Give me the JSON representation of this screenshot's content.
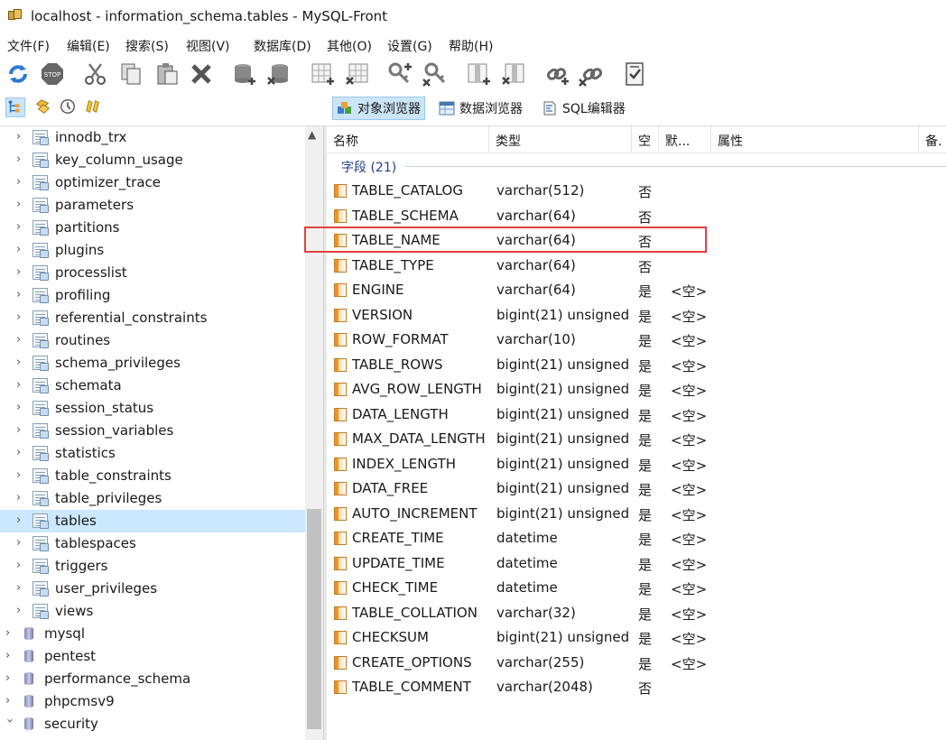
{
  "window": {
    "title": "localhost - information_schema.tables - MySQL-Front"
  },
  "menu": [
    "文件(F)",
    "编辑(E)",
    "搜索(S)",
    "视图(V)",
    "数据库(D)",
    "其他(O)",
    "设置(G)",
    "帮助(H)"
  ],
  "views": {
    "object_browser": "对象浏览器",
    "data_browser": "数据浏览器",
    "sql_editor": "SQL编辑器"
  },
  "tree": {
    "items": [
      {
        "label": "innodb_trx",
        "kind": "table"
      },
      {
        "label": "key_column_usage",
        "kind": "table"
      },
      {
        "label": "optimizer_trace",
        "kind": "table"
      },
      {
        "label": "parameters",
        "kind": "table"
      },
      {
        "label": "partitions",
        "kind": "table"
      },
      {
        "label": "plugins",
        "kind": "table"
      },
      {
        "label": "processlist",
        "kind": "table"
      },
      {
        "label": "profiling",
        "kind": "table"
      },
      {
        "label": "referential_constraints",
        "kind": "table"
      },
      {
        "label": "routines",
        "kind": "table"
      },
      {
        "label": "schema_privileges",
        "kind": "table"
      },
      {
        "label": "schemata",
        "kind": "table"
      },
      {
        "label": "session_status",
        "kind": "table"
      },
      {
        "label": "session_variables",
        "kind": "table"
      },
      {
        "label": "statistics",
        "kind": "table"
      },
      {
        "label": "table_constraints",
        "kind": "table"
      },
      {
        "label": "table_privileges",
        "kind": "table"
      },
      {
        "label": "tables",
        "kind": "table",
        "selected": true
      },
      {
        "label": "tablespaces",
        "kind": "table"
      },
      {
        "label": "triggers",
        "kind": "table"
      },
      {
        "label": "user_privileges",
        "kind": "table"
      },
      {
        "label": "views",
        "kind": "table"
      },
      {
        "label": "mysql",
        "kind": "database"
      },
      {
        "label": "pentest",
        "kind": "database"
      },
      {
        "label": "performance_schema",
        "kind": "database"
      },
      {
        "label": "phpcmsv9",
        "kind": "database"
      },
      {
        "label": "security",
        "kind": "database",
        "expanded": true
      }
    ]
  },
  "grid": {
    "columns": [
      "名称",
      "类型",
      "空",
      "默...",
      "属性",
      "备."
    ],
    "group_label": "字段 (21)",
    "rows": [
      {
        "name": "TABLE_CATALOG",
        "type": "varchar(512)",
        "null": "否",
        "default": ""
      },
      {
        "name": "TABLE_SCHEMA",
        "type": "varchar(64)",
        "null": "否",
        "default": ""
      },
      {
        "name": "TABLE_NAME",
        "type": "varchar(64)",
        "null": "否",
        "default": ""
      },
      {
        "name": "TABLE_TYPE",
        "type": "varchar(64)",
        "null": "否",
        "default": ""
      },
      {
        "name": "ENGINE",
        "type": "varchar(64)",
        "null": "是",
        "default": "<空>"
      },
      {
        "name": "VERSION",
        "type": "bigint(21) unsigned",
        "null": "是",
        "default": "<空>"
      },
      {
        "name": "ROW_FORMAT",
        "type": "varchar(10)",
        "null": "是",
        "default": "<空>"
      },
      {
        "name": "TABLE_ROWS",
        "type": "bigint(21) unsigned",
        "null": "是",
        "default": "<空>"
      },
      {
        "name": "AVG_ROW_LENGTH",
        "type": "bigint(21) unsigned",
        "null": "是",
        "default": "<空>"
      },
      {
        "name": "DATA_LENGTH",
        "type": "bigint(21) unsigned",
        "null": "是",
        "default": "<空>"
      },
      {
        "name": "MAX_DATA_LENGTH",
        "type": "bigint(21) unsigned",
        "null": "是",
        "default": "<空>"
      },
      {
        "name": "INDEX_LENGTH",
        "type": "bigint(21) unsigned",
        "null": "是",
        "default": "<空>"
      },
      {
        "name": "DATA_FREE",
        "type": "bigint(21) unsigned",
        "null": "是",
        "default": "<空>"
      },
      {
        "name": "AUTO_INCREMENT",
        "type": "bigint(21) unsigned",
        "null": "是",
        "default": "<空>"
      },
      {
        "name": "CREATE_TIME",
        "type": "datetime",
        "null": "是",
        "default": "<空>"
      },
      {
        "name": "UPDATE_TIME",
        "type": "datetime",
        "null": "是",
        "default": "<空>"
      },
      {
        "name": "CHECK_TIME",
        "type": "datetime",
        "null": "是",
        "default": "<空>"
      },
      {
        "name": "TABLE_COLLATION",
        "type": "varchar(32)",
        "null": "是",
        "default": "<空>"
      },
      {
        "name": "CHECKSUM",
        "type": "bigint(21) unsigned",
        "null": "是",
        "default": "<空>"
      },
      {
        "name": "CREATE_OPTIONS",
        "type": "varchar(255)",
        "null": "是",
        "default": "<空>"
      },
      {
        "name": "TABLE_COMMENT",
        "type": "varchar(2048)",
        "null": "否",
        "default": ""
      }
    ]
  },
  "colors": {
    "highlight": "#e04040",
    "selection": "#cce8ff",
    "group_text": "#1e3f8f"
  }
}
